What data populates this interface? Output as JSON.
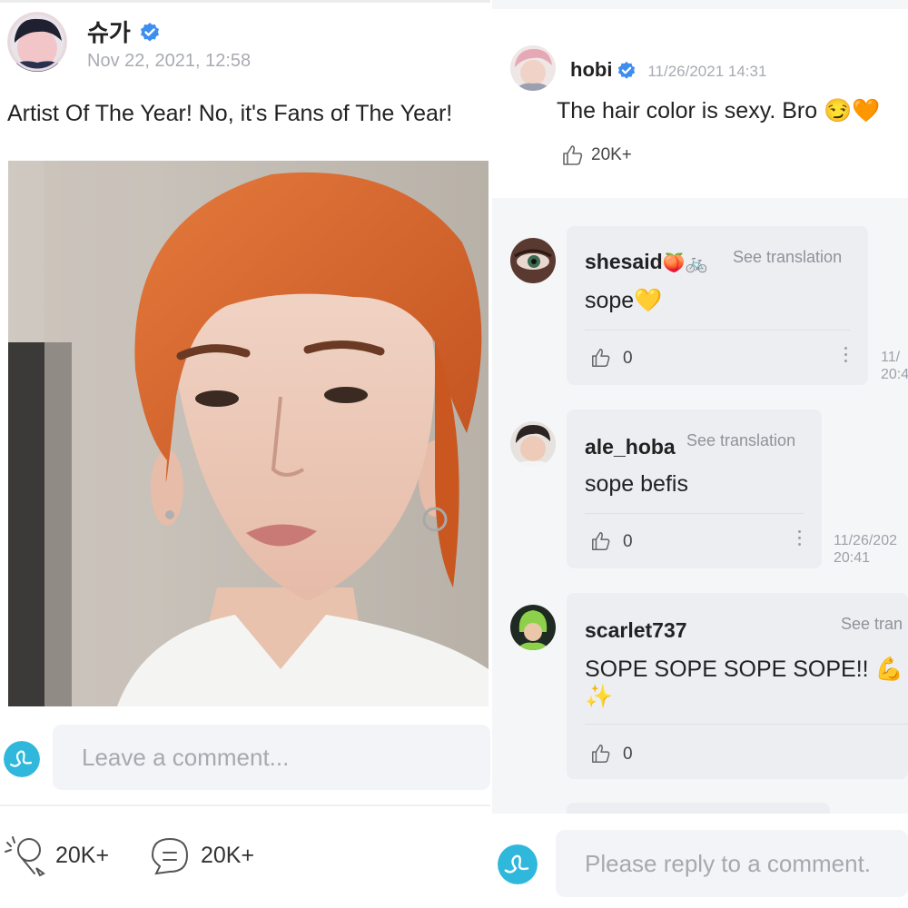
{
  "post": {
    "author": "슈가",
    "timestamp": "Nov 22, 2021, 12:58",
    "text": "Artist Of The Year! No, it's Fans of The Year!",
    "comment_placeholder": "Leave a comment...",
    "like_count": "20K+",
    "comment_count": "20K+"
  },
  "reply": {
    "author": "hobi",
    "timestamp": "11/26/2021 14:31",
    "text": "The hair color is sexy. Bro",
    "emoji": "😏🧡",
    "like_count": "20K+",
    "reply_placeholder": "Please reply to a comment."
  },
  "comments": [
    {
      "user": "shesaid",
      "user_emoji": "🍑🚲",
      "see_translation": "See translation",
      "text": "sope",
      "text_emoji": "💛",
      "likes": "0",
      "time_line1": "11/",
      "time_line2": "20:4"
    },
    {
      "user": "ale_hoba",
      "see_translation": "See translation",
      "text": "sope befis",
      "likes": "0",
      "time_line1": "11/26/202",
      "time_line2": "20:41"
    },
    {
      "user": "scarlet737",
      "see_translation": "See tran",
      "text": "SOPE SOPE SOPE SOPE!!",
      "text_emoji": "💪",
      "text_emoji2": "✨",
      "likes": "0"
    }
  ],
  "colors": {
    "verified": "#3d8ef0",
    "brand": "#2fb8dc",
    "hair": "#d9622b"
  }
}
